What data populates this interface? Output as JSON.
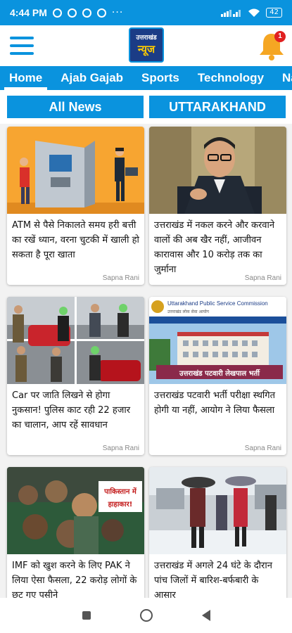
{
  "status_bar": {
    "time": "4:44 PM",
    "dots": "···",
    "battery": "42"
  },
  "header": {
    "logo_line1": "उत्तराखंड",
    "logo_line2": "न्यूज",
    "notification_count": "1"
  },
  "nav_tabs": [
    "Home",
    "Ajab Gajab",
    "Sports",
    "Technology",
    "Nation"
  ],
  "section_buttons": [
    "All News",
    "UTTARAKHAND"
  ],
  "articles": [
    {
      "title": "ATM से पैसे निकालते समय हरी बत्ती का रखें ध्यान, वरना चुटकी में खाली हो सकता है पूरा खाता",
      "author": "Sapna Rani"
    },
    {
      "title": "उत्तराखंड में नकल करने और करवाने वालों की अब खैर नहीं, आजीवन कारावास और 10 करोड़ तक का जुर्माना",
      "author": "Sapna Rani"
    },
    {
      "title": "Car पर जाति लिखने से होगा नुकसान! पुलिस काट रही 22 हजार का चालान, आप रहें सावधान",
      "author": "Sapna Rani"
    },
    {
      "title": "उत्तराखंड पटवारी भर्ती परीक्षा स्थगित होगी या नहीं, आयोग ने लिया फैसला",
      "author": "Sapna Rani"
    },
    {
      "title": "IMF को खुश करने के लिए PAK ने लिया ऐसा फैसला, 22 करोड़ लोगों के छूट गए पसीने",
      "author": ""
    },
    {
      "title": "उत्तराखंड में अगले 24 घंटे के दौरान पांच जिलों में बारिश-बर्फबारी के आसार",
      "author": ""
    }
  ],
  "image_captions": {
    "ukpsc_banner": "Uttarakhand Public Service Commission",
    "ukpsc_sub": "उत्तराखंड लोक सेवा आयोग",
    "patwari_overlay": "उत्तराखंड पटवारी लेखपाल भर्ती",
    "pak_overlay_1": "पाकिस्तान में",
    "pak_overlay_2": "हाहाकार!"
  },
  "colors": {
    "primary": "#0a93de",
    "bell": "#f5a623",
    "badge": "#e02020"
  }
}
